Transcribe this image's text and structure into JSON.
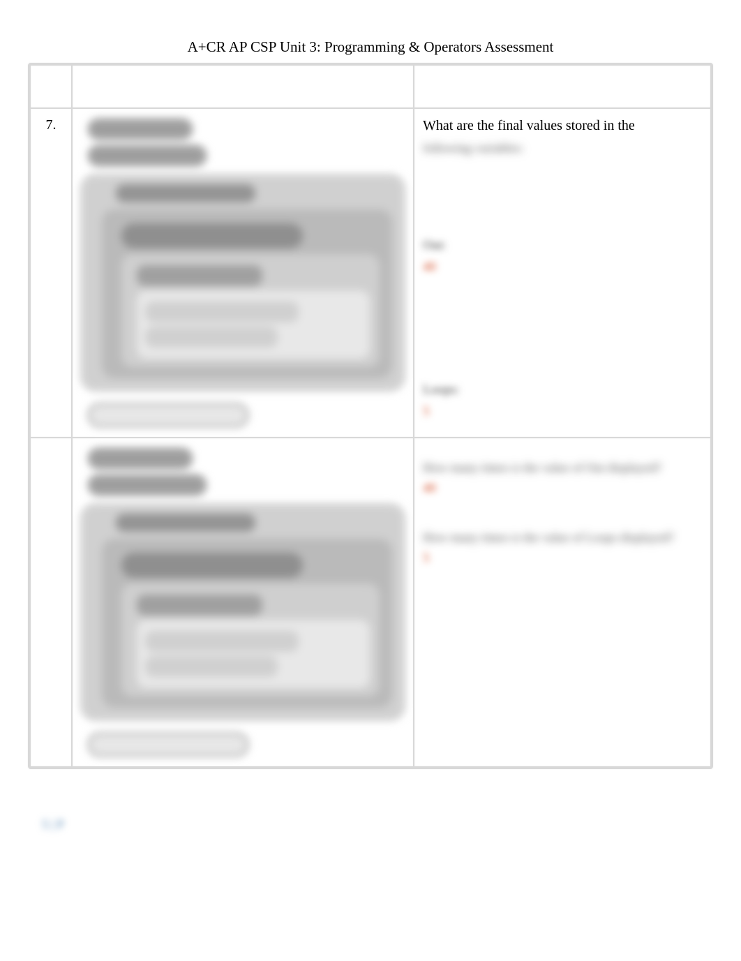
{
  "header": {
    "title": "A+CR AP CSP Unit 3: Programming & Operators Assessment"
  },
  "questions": [
    {
      "number": "7.",
      "prompt_line1": "What are the final values stored in the",
      "prompt_line2": "following variables:",
      "var1_label": "Out:",
      "var1_answer": "40",
      "var2_label": "Loops:",
      "var2_answer": "5"
    },
    {
      "number": "",
      "q1": "How many times is the value of Out displayed?",
      "a1": "40",
      "q2": "How many times is the value of Loops displayed?",
      "a2": "5"
    }
  ],
  "footer": {
    "page": "5 | P"
  }
}
